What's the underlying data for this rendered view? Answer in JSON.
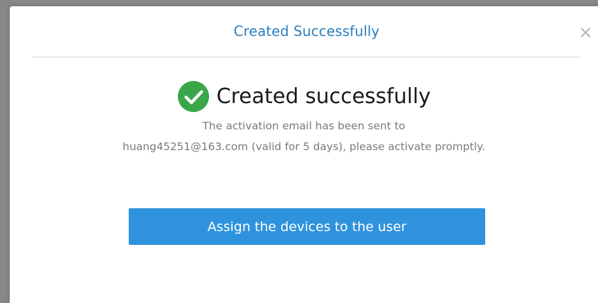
{
  "dialog": {
    "title": "Created Successfully",
    "close_icon": "close-icon",
    "accent_color": "#2a7fc0"
  },
  "result": {
    "icon": "check-circle-icon",
    "icon_color": "#3aa64a",
    "headline": "Created successfully",
    "message_line1": "The activation email has been sent to",
    "message_line2": "huang45251@163.com (valid for 5 days), please activate promptly."
  },
  "actions": {
    "assign_label": "Assign the devices to the user",
    "button_color": "#2e93dc"
  }
}
